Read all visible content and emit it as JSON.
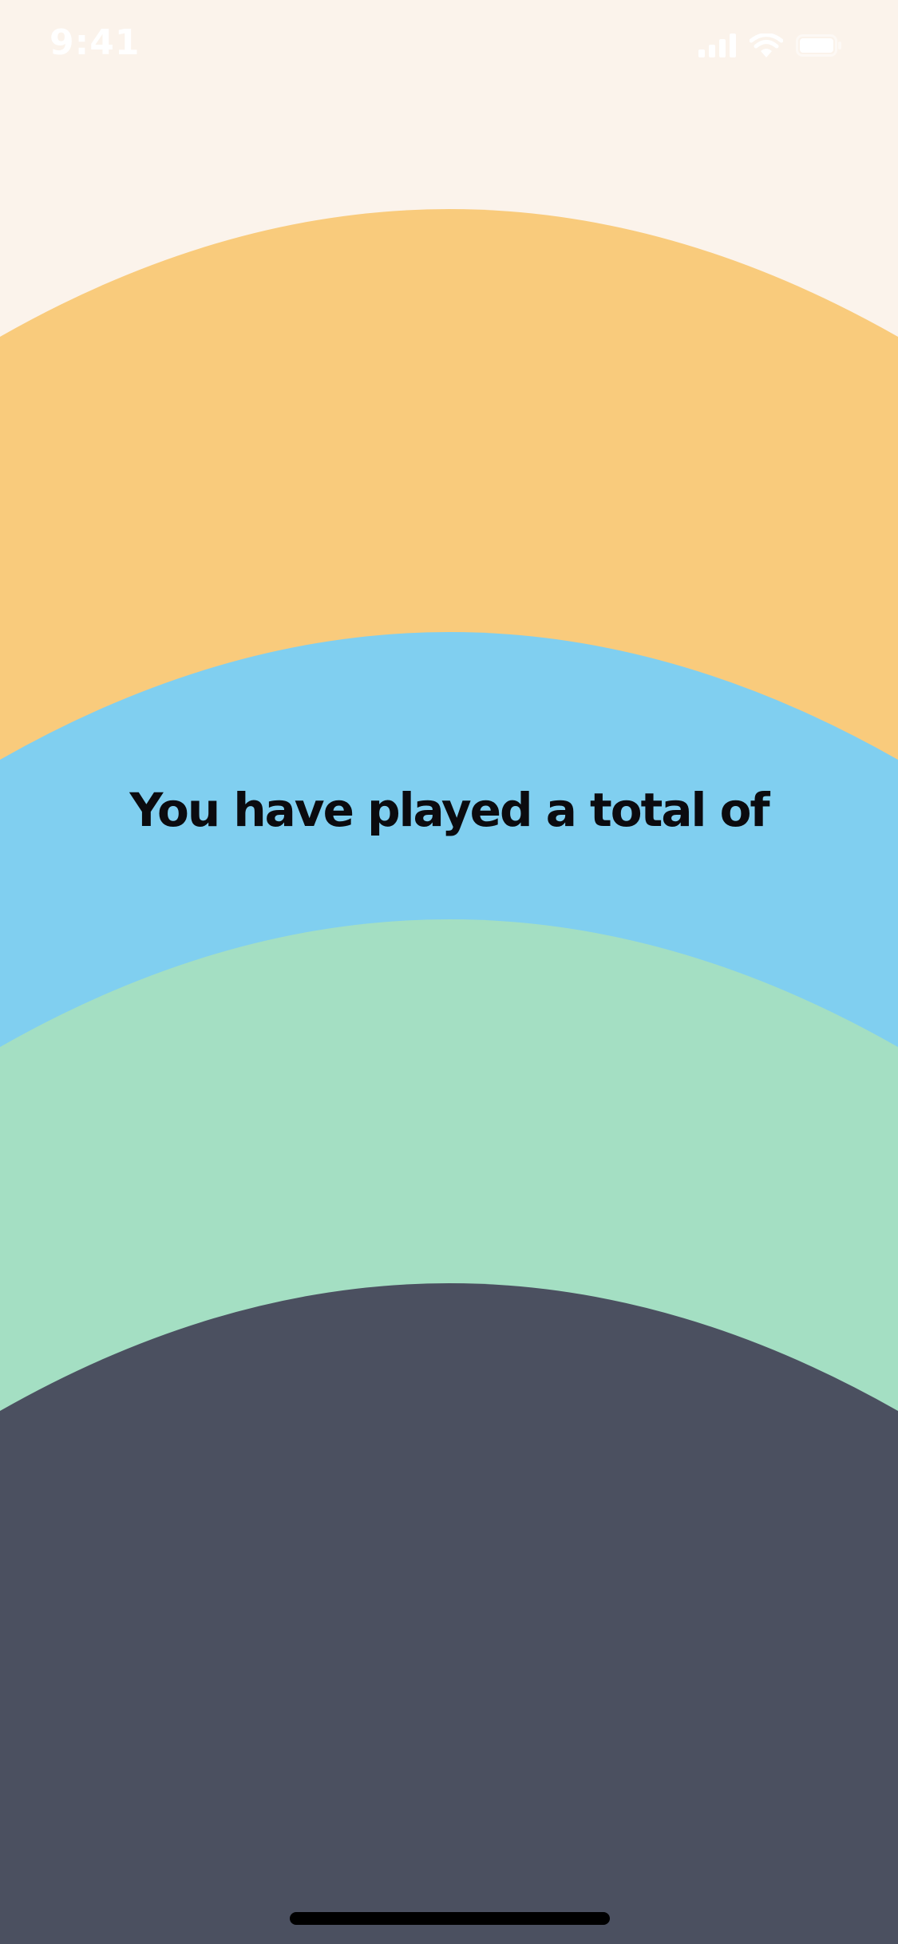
{
  "status_bar": {
    "time": "9:41",
    "icons": [
      "cellular-signal-icon",
      "wifi-icon",
      "battery-icon"
    ],
    "icon_color": "#ffffff"
  },
  "headline": {
    "text": "You have played a total of",
    "color": "#0b0b0f"
  },
  "colors": {
    "background": "#fbf3eb",
    "arc_orange": "#f9cb7c",
    "arc_blue": "#80cff0",
    "arc_green": "#a4dfc3",
    "arc_dark": "#4b5060",
    "home_indicator": "#000000"
  }
}
